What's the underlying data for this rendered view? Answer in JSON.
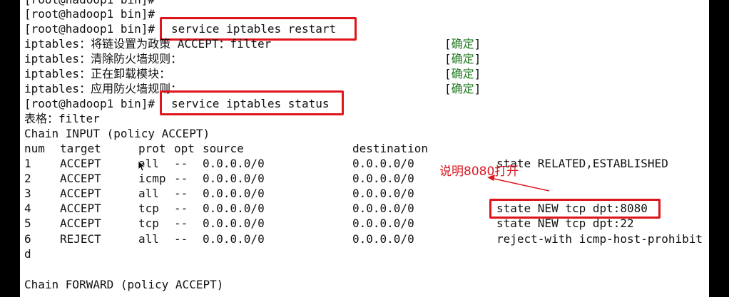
{
  "terminal": {
    "lines": [
      "[root@hadoop1 bin]#",
      "[root@hadoop1 bin]#",
      "[root@hadoop1 bin]#",
      "iptables：将链设置为政策 ACCEPT：filter",
      "iptables：清除防火墙规则：",
      "iptables：正在卸载模块：",
      "iptables：应用防火墙规则：",
      "[root@hadoop1 bin]#",
      "表格：filter",
      "Chain INPUT (policy ACCEPT)",
      "d",
      "Chain FORWARD (policy ACCEPT)"
    ],
    "commands": {
      "restart": "service iptables restart",
      "status": "service iptables status"
    },
    "ok_labels": [
      "[",
      "确定",
      "]"
    ],
    "table": {
      "headers": [
        "num",
        "target",
        "prot",
        "opt",
        "source",
        "destination"
      ],
      "rows": [
        {
          "num": "1",
          "target": "ACCEPT",
          "prot": "all",
          "opt": "--",
          "source": "0.0.0.0/0",
          "destination": "0.0.0.0/0",
          "extra": "state RELATED,ESTABLISHED"
        },
        {
          "num": "2",
          "target": "ACCEPT",
          "prot": "icmp",
          "opt": "--",
          "source": "0.0.0.0/0",
          "destination": "0.0.0.0/0",
          "extra": ""
        },
        {
          "num": "3",
          "target": "ACCEPT",
          "prot": "all",
          "opt": "--",
          "source": "0.0.0.0/0",
          "destination": "0.0.0.0/0",
          "extra": ""
        },
        {
          "num": "4",
          "target": "ACCEPT",
          "prot": "tcp",
          "opt": "--",
          "source": "0.0.0.0/0",
          "destination": "0.0.0.0/0",
          "extra": "state NEW tcp dpt:8080"
        },
        {
          "num": "5",
          "target": "ACCEPT",
          "prot": "tcp",
          "opt": "--",
          "source": "0.0.0.0/0",
          "destination": "0.0.0.0/0",
          "extra": "state NEW tcp dpt:22"
        },
        {
          "num": "6",
          "target": "REJECT",
          "prot": "all",
          "opt": "--",
          "source": "0.0.0.0/0",
          "destination": "0.0.0.0/0",
          "extra": "reject-with icmp-host-prohibit"
        }
      ]
    }
  },
  "annotation": {
    "text": "说明8080打开"
  },
  "colors": {
    "highlight": "#e0141b",
    "ok": "#1f7a1f",
    "frame": "#000000"
  }
}
